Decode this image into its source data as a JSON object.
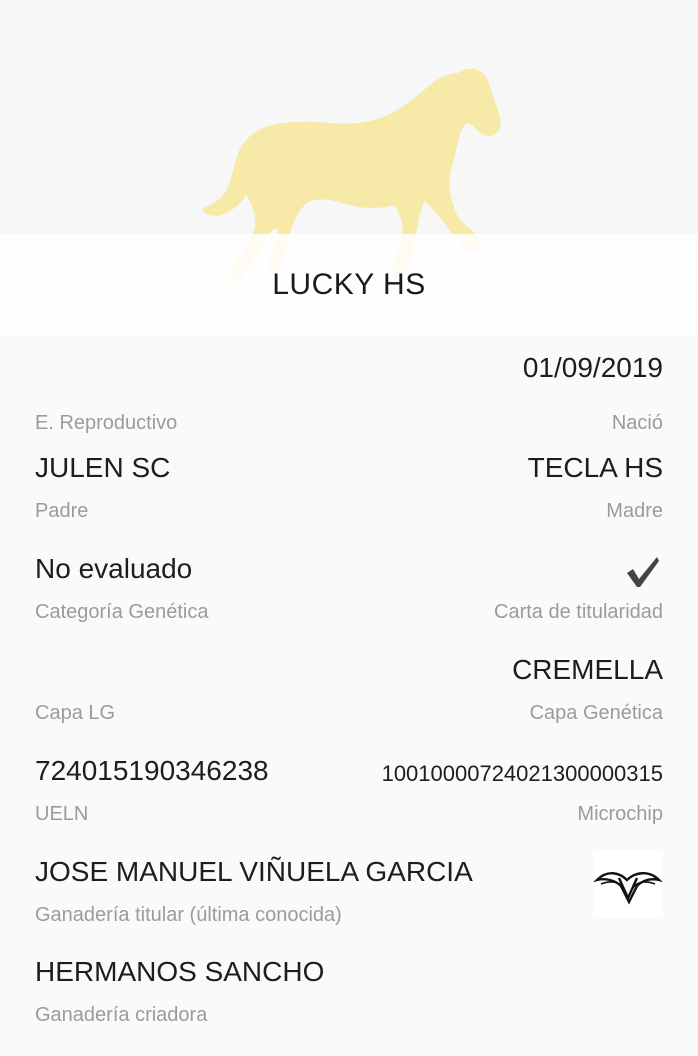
{
  "horse": {
    "name": "LUCKY HS"
  },
  "fields": {
    "e_reproductivo": {
      "label": "E. Reproductivo",
      "value": ""
    },
    "nacio": {
      "label": "Nació",
      "value": "01/09/2019"
    },
    "padre": {
      "label": "Padre",
      "value": "JULEN SC"
    },
    "madre": {
      "label": "Madre",
      "value": "TECLA HS"
    },
    "categoria_genetica": {
      "label": "Categoría Genética",
      "value": "No evaluado"
    },
    "carta_titularidad": {
      "label": "Carta de titularidad",
      "icon": "checkmark-icon"
    },
    "capa_lg": {
      "label": "Capa LG",
      "value": ""
    },
    "capa_genetica": {
      "label": "Capa Genética",
      "value": "CREMELLA"
    },
    "ueln": {
      "label": "UELN",
      "value": "724015190346238"
    },
    "microchip": {
      "label": "Microchip",
      "value": "10010000724021300000315"
    },
    "ganaderia_titular": {
      "label": "Ganadería titular (última conocida)",
      "value": "JOSE MANUEL VIÑUELA GARCIA",
      "logo": "breeder-logo-icon"
    },
    "ganaderia_criadora": {
      "label": "Ganadería criadora",
      "value": "HERMANOS SANCHO"
    }
  },
  "colors": {
    "horse_silhouette": "#f7e9a8",
    "value_text": "#1d1d1d",
    "label_text": "#9b9b9b",
    "check": "#444444"
  }
}
